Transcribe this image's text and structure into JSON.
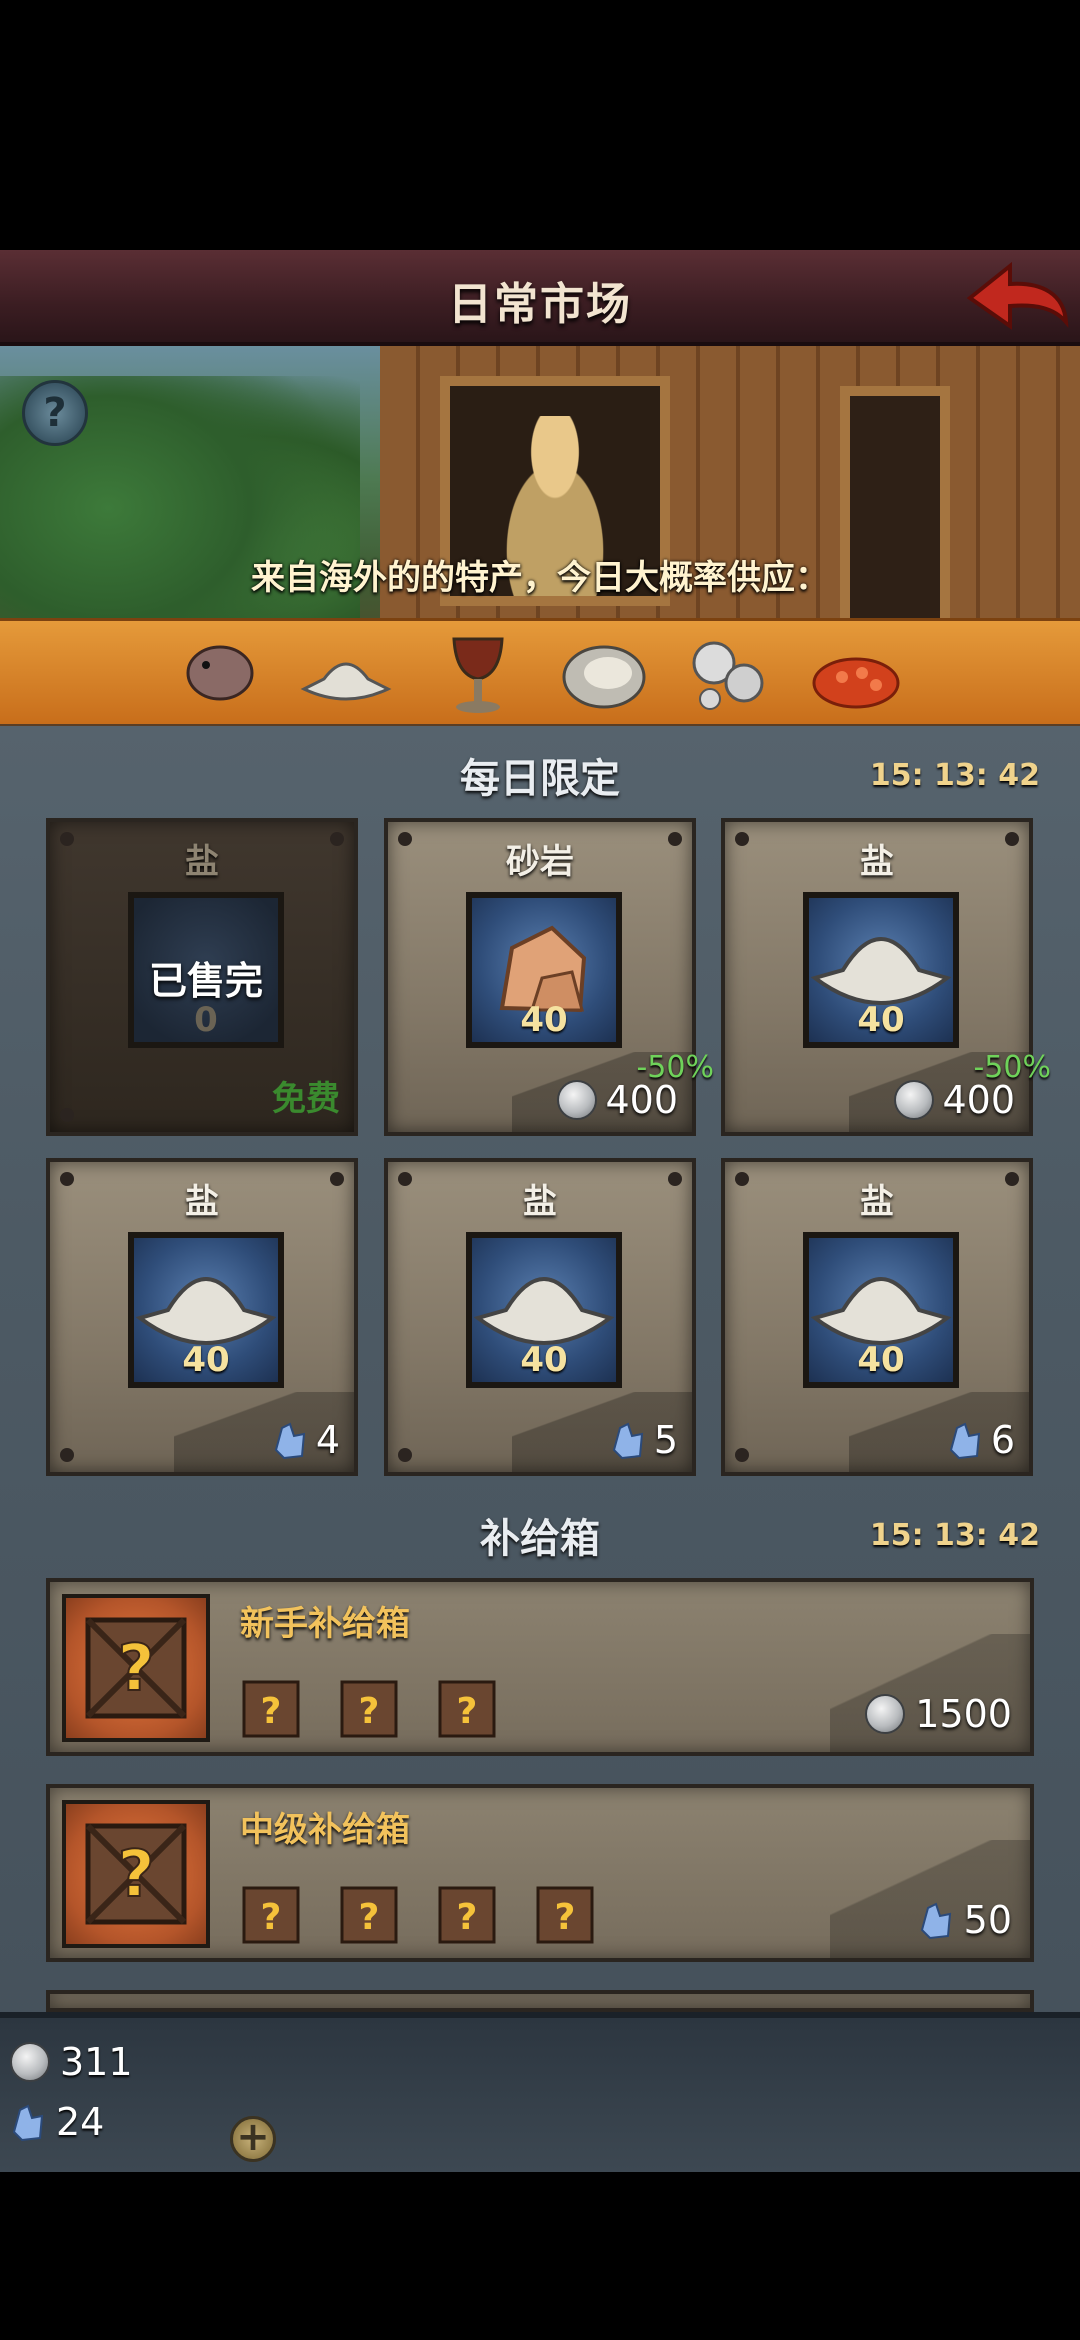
{
  "header": {
    "title": "日常市场"
  },
  "banner": {
    "text": "来自海外的的特产，今日大概率供应：",
    "goods_icons": [
      "fish-icon",
      "salt-icon",
      "chalice-icon",
      "oyster-icon",
      "pearls-icon",
      "caviar-icon"
    ]
  },
  "daily": {
    "title": "每日限定",
    "timer": "15: 13: 42",
    "cards": [
      {
        "name": "盐",
        "qty": "0",
        "soldout": "已售完",
        "price_label": "免费",
        "currency": "free"
      },
      {
        "name": "砂岩",
        "qty": "40",
        "discount": "-50%",
        "price": "400",
        "currency": "coin"
      },
      {
        "name": "盐",
        "qty": "40",
        "discount": "-50%",
        "price": "400",
        "currency": "coin"
      },
      {
        "name": "盐",
        "qty": "40",
        "price": "4",
        "currency": "gem"
      },
      {
        "name": "盐",
        "qty": "40",
        "price": "5",
        "currency": "gem"
      },
      {
        "name": "盐",
        "qty": "40",
        "price": "6",
        "currency": "gem"
      }
    ]
  },
  "supply": {
    "title": "补给箱",
    "timer": "15: 13: 42",
    "boxes": [
      {
        "name": "新手补给箱",
        "minis": 3,
        "price": "1500",
        "currency": "coin"
      },
      {
        "name": "中级补给箱",
        "minis": 4,
        "price": "50",
        "currency": "gem"
      }
    ]
  },
  "resources": {
    "coins": "311",
    "gems": "24"
  },
  "colors": {
    "accent_gold": "#f2c25c",
    "discount_green": "#6fd25a",
    "header_bg": "#3b1d22"
  }
}
